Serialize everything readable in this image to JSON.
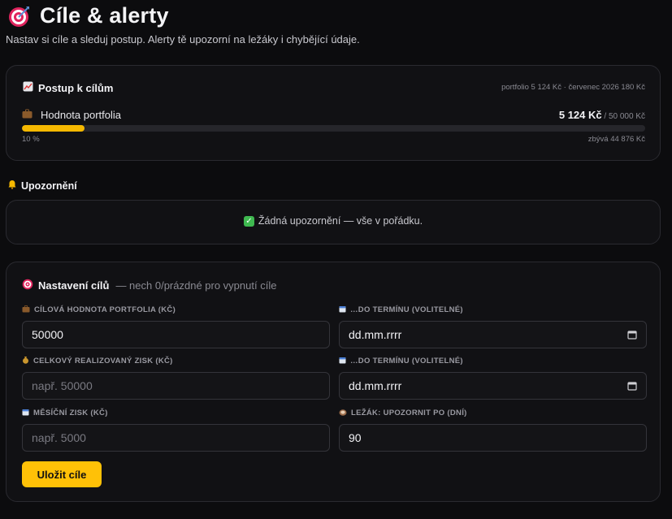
{
  "header": {
    "title_icon": "target-icon",
    "title": "Cíle & alerty",
    "subtitle": "Nastav si cíle a sleduj postup. Alerty tě upozorní na ležáky i chybějící údaje."
  },
  "progress": {
    "icon": "chart-up-icon",
    "title": "Postup k cílům",
    "meta": "portfolio 5 124 Kč · červenec 2026 180 Kč",
    "goal_icon": "briefcase-icon",
    "goal_label": "Hodnota portfolia",
    "current": "5 124 Kč",
    "target": "/ 50 000 Kč",
    "fraction": 0.1,
    "percent_label": "10 %",
    "remaining": "zbývá 44 876 Kč",
    "bar_color": "#f5b800"
  },
  "alerts": {
    "icon": "bell-icon",
    "title": "Upozornění",
    "message_icon": "check-icon",
    "message": "Žádná upozornění — vše v pořádku."
  },
  "settings": {
    "icon": "target-icon",
    "title": "Nastavení cílů",
    "hint": "— nech 0/prázdné pro vypnutí cíle",
    "fields": [
      {
        "icon": "briefcase-icon",
        "label": "CÍLOVÁ HODNOTA PORTFOLIA (KČ)",
        "value": "50000",
        "placeholder": ""
      },
      {
        "icon": "calendar-icon",
        "label": "…DO TERMÍNU (VOLITELNÉ)",
        "value": "dd.mm.rrrr",
        "placeholder": ""
      },
      {
        "icon": "money-bag-icon",
        "label": "CELKOVÝ REALIZOVANÝ ZISK (KČ)",
        "value": "",
        "placeholder": "např. 50000"
      },
      {
        "icon": "calendar-icon",
        "label": "…DO TERMÍNU (VOLITELNÉ)",
        "value": "dd.mm.rrrr",
        "placeholder": ""
      },
      {
        "icon": "calendar-icon",
        "label": "MĚSÍČNÍ ZISK (KČ)",
        "value": "",
        "placeholder": "např. 5000"
      },
      {
        "icon": "sloth-icon",
        "label": "LEŽÁK: UPOZORNIT PO (DNÍ)",
        "value": "90",
        "placeholder": ""
      }
    ],
    "save_label": "Uložit cíle",
    "accent": "#ffc107"
  }
}
